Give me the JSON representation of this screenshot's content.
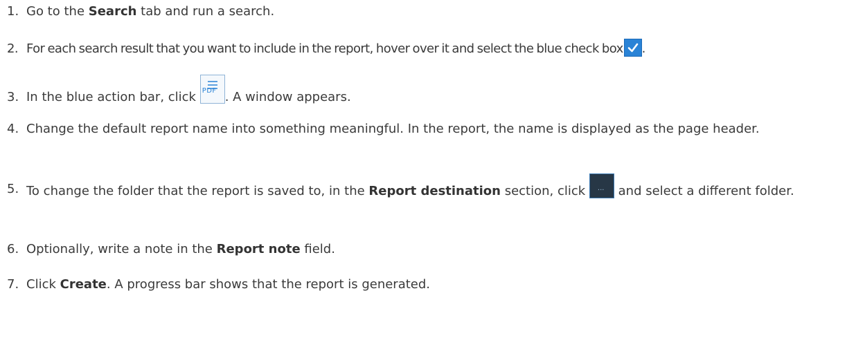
{
  "steps": [
    {
      "num": "1.",
      "pre": "Go to the ",
      "bold": "Search",
      "post": " tab and run a search."
    },
    {
      "num": "2.",
      "text": "For each search result that you want to include in the report, hover over it and select the blue check box",
      "after": "."
    },
    {
      "num": "3.",
      "pre": "In the blue action bar, click ",
      "icon_label": "PDF",
      "post": ". A window appears."
    },
    {
      "num": "4.",
      "text": "Change the default report name into something meaningful. In the report, the name is displayed as the page header."
    },
    {
      "num": "5.",
      "pre": "To change the folder that the report is saved to, in the ",
      "bold": "Report destination",
      "mid": " section, click ",
      "icon_label": "...",
      "post": " and select a different folder."
    },
    {
      "num": "6.",
      "pre": "Optionally, write a note in the ",
      "bold": "Report note",
      "post": " field."
    },
    {
      "num": "7.",
      "pre": "Click ",
      "bold": "Create",
      "post": ". A progress bar shows that the report is generated."
    }
  ],
  "icons": {
    "check": "check-box-icon",
    "pdf": "pdf-icon",
    "browse": "browse-folder-icon"
  },
  "colors": {
    "text": "#3a3a3a",
    "accent_blue": "#2a83d6",
    "dark_button": "#273746"
  }
}
